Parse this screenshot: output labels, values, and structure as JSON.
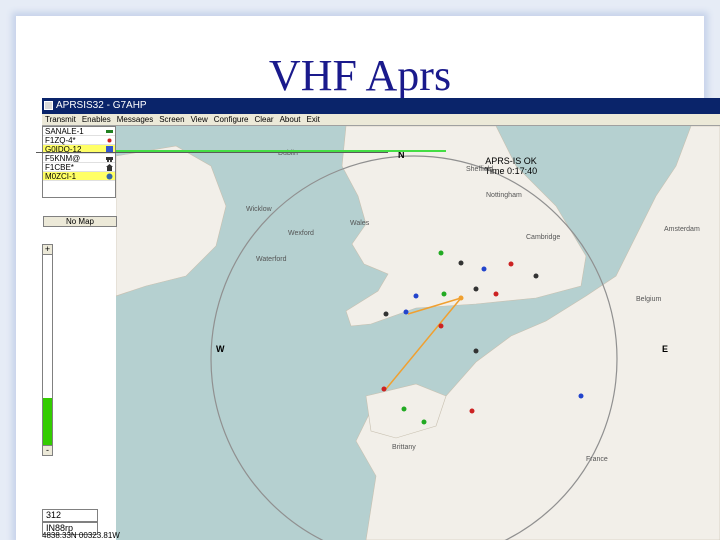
{
  "slide": {
    "title": "VHF Aprs"
  },
  "window": {
    "title": "APRSIS32 - G7AHP",
    "menu": [
      "Transmit",
      "Enables",
      "Messages",
      "Screen",
      "View",
      "Configure",
      "Clear",
      "About",
      "Exit"
    ]
  },
  "stations": [
    {
      "call": "SANALE-1",
      "icon": "digi-icon"
    },
    {
      "call": "F1ZQ-4*",
      "icon": "red-dot-icon"
    },
    {
      "call": "G0IDQ-12",
      "icon": "dx-icon"
    },
    {
      "call": "F5KNM@",
      "icon": "car-icon"
    },
    {
      "call": "F1CBE*",
      "icon": "house-icon"
    },
    {
      "call": "M0ZCI-1",
      "icon": "wx-icon"
    }
  ],
  "no_map_label": "No Map",
  "status": {
    "line1": "APRS-IS OK",
    "line2": "Time 0:17:40"
  },
  "compass": {
    "n": "N",
    "w": "W",
    "e": "E"
  },
  "map_labels": {
    "dublin": "Dublin",
    "wales": "Wales",
    "wicklow": "Wicklow",
    "wexford": "Wexford",
    "waterford": "Waterford",
    "amsterdam": "Amsterdam",
    "cambridge": "Cambridge",
    "sheffield": "Sheffield",
    "nottingham": "Nottingham",
    "belgium": "Belgium",
    "france": "France",
    "brittany": "Brittany"
  },
  "zoom": {
    "plus": "+",
    "minus": "-",
    "level": 0.27
  },
  "range_value": "312",
  "locator": "IN88rp",
  "coords": "4838.33N 00323.81W",
  "colors": {
    "titlebar": "#0a246a",
    "sea": "#b5d0d0",
    "land": "#f2efe9",
    "track": "#f0a030",
    "range_ring": "#909090"
  }
}
